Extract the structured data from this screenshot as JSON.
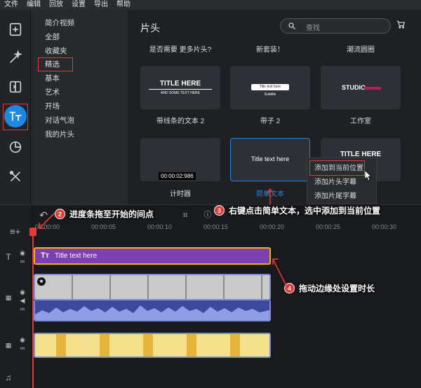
{
  "menubar": {
    "items": [
      "文件",
      "编辑",
      "回放",
      "设置",
      "导出",
      "帮助"
    ]
  },
  "categories": {
    "items": [
      "简介视频",
      "全部",
      "收藏夹",
      "精选",
      "基本",
      "艺术",
      "开场",
      "对话气泡",
      "我的片头"
    ],
    "selected_index": 3
  },
  "panel": {
    "title": "片头",
    "search_placeholder": "查找",
    "section_labels": [
      "是否需要 更多片头?",
      "新套装！",
      "潮流圆圈"
    ],
    "thumbs": [
      {
        "title": "TITLE HERE",
        "subtitle": "AND SOME TEXT HERE",
        "caption": "带线条的文本 2"
      },
      {
        "title": "Title text here",
        "subtitle": "Subtitle",
        "caption": "带子 2"
      },
      {
        "title": "STUDIO",
        "subtitle": "",
        "caption": "工作室"
      },
      {
        "title": "",
        "subtitle": "00:00:02:986",
        "caption": "计时器"
      },
      {
        "title": "Title text here",
        "subtitle": "",
        "caption": "简单文本"
      },
      {
        "title": "TITLE HERE",
        "subtitle": "",
        "caption": ""
      }
    ]
  },
  "context_menu": {
    "items": [
      "添加到当前位置",
      "添加片头字幕",
      "添加片尾字幕"
    ]
  },
  "timeline": {
    "ruler": [
      "00:00:00",
      "00:00:05",
      "00:00:10",
      "00:00:15",
      "00:00:20",
      "00:00:25",
      "00:00:30"
    ],
    "title_clip": "Title text here"
  },
  "callouts": [
    {
      "num": "1",
      "text": ""
    },
    {
      "num": "2",
      "text": "进度条拖至开始的间点"
    },
    {
      "num": "3",
      "text": "右键点击简单文本，选中添加到当前位置"
    },
    {
      "num": "4",
      "text": "拖动边缘处设置时长"
    }
  ],
  "colors": {
    "accent": "#1e88e5",
    "callout_red": "#e53935",
    "title_clip": "#7b3fb0",
    "audio_wave": "#5566c4"
  }
}
